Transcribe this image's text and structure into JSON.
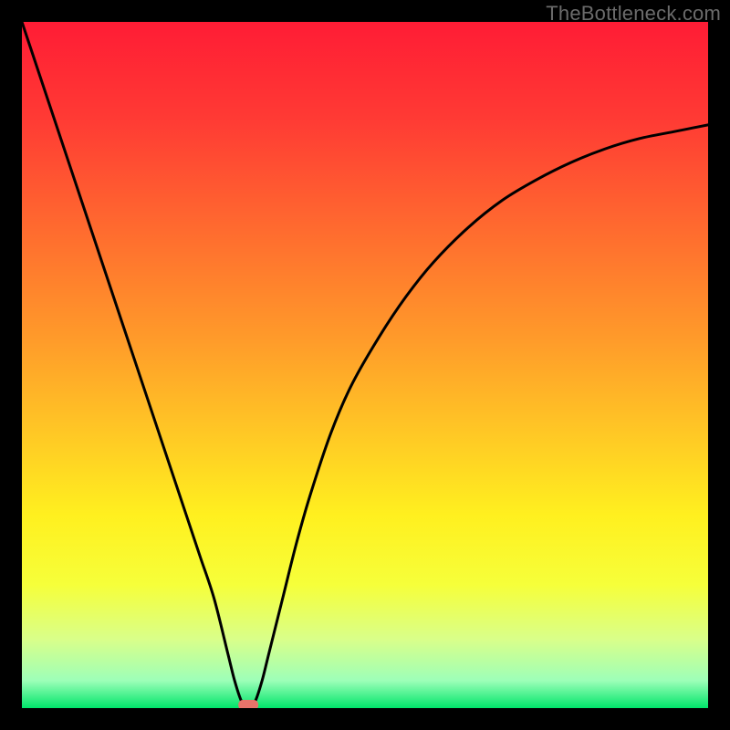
{
  "watermark": "TheBottleneck.com",
  "chart_data": {
    "type": "line",
    "title": "",
    "xlabel": "",
    "ylabel": "",
    "xlim": [
      0,
      100
    ],
    "ylim": [
      0,
      100
    ],
    "x": [
      0,
      2,
      4,
      6,
      8,
      10,
      12,
      14,
      16,
      18,
      20,
      22,
      24,
      26,
      28,
      30,
      31,
      32,
      33,
      34,
      35,
      36,
      38,
      40,
      42,
      45,
      48,
      52,
      56,
      60,
      65,
      70,
      75,
      80,
      85,
      90,
      95,
      100
    ],
    "values": [
      100,
      94,
      88,
      82,
      76,
      70,
      64,
      58,
      52,
      46,
      40,
      34,
      28,
      22,
      16,
      8,
      4,
      1,
      0,
      1,
      4,
      8,
      16,
      24,
      31,
      40,
      47,
      54,
      60,
      65,
      70,
      74,
      77,
      79.5,
      81.5,
      83,
      84,
      85
    ],
    "marker": {
      "x": 33,
      "y": 0,
      "color": "#e8736a"
    },
    "background_gradient": {
      "type": "vertical",
      "stops": [
        {
          "pos": 0.0,
          "color": "#ff1c35"
        },
        {
          "pos": 0.14,
          "color": "#ff3a34"
        },
        {
          "pos": 0.3,
          "color": "#ff6a2f"
        },
        {
          "pos": 0.46,
          "color": "#ff9a2a"
        },
        {
          "pos": 0.6,
          "color": "#ffc825"
        },
        {
          "pos": 0.72,
          "color": "#fff01f"
        },
        {
          "pos": 0.82,
          "color": "#f6ff3a"
        },
        {
          "pos": 0.9,
          "color": "#d9ff8a"
        },
        {
          "pos": 0.96,
          "color": "#9dffb8"
        },
        {
          "pos": 1.0,
          "color": "#00e56a"
        }
      ]
    }
  }
}
